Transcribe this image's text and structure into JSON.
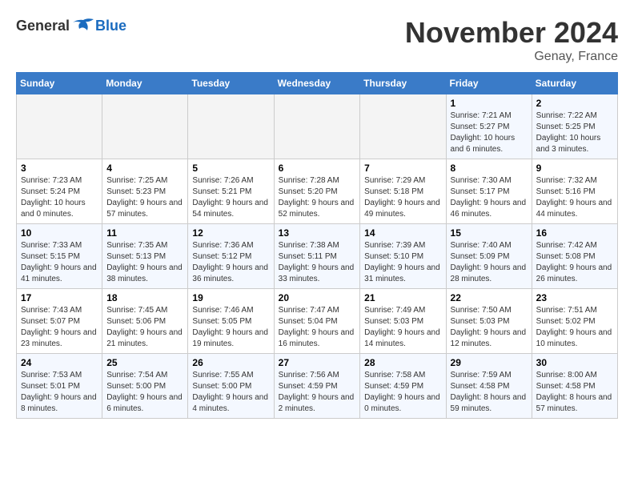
{
  "logo": {
    "general": "General",
    "blue": "Blue"
  },
  "title": "November 2024",
  "location": "Genay, France",
  "days_header": [
    "Sunday",
    "Monday",
    "Tuesday",
    "Wednesday",
    "Thursday",
    "Friday",
    "Saturday"
  ],
  "weeks": [
    [
      {
        "num": "",
        "empty": true
      },
      {
        "num": "",
        "empty": true
      },
      {
        "num": "",
        "empty": true
      },
      {
        "num": "",
        "empty": true
      },
      {
        "num": "",
        "empty": true
      },
      {
        "num": "1",
        "sunrise": "Sunrise: 7:21 AM",
        "sunset": "Sunset: 5:27 PM",
        "daylight": "Daylight: 10 hours and 6 minutes."
      },
      {
        "num": "2",
        "sunrise": "Sunrise: 7:22 AM",
        "sunset": "Sunset: 5:25 PM",
        "daylight": "Daylight: 10 hours and 3 minutes."
      }
    ],
    [
      {
        "num": "3",
        "sunrise": "Sunrise: 7:23 AM",
        "sunset": "Sunset: 5:24 PM",
        "daylight": "Daylight: 10 hours and 0 minutes."
      },
      {
        "num": "4",
        "sunrise": "Sunrise: 7:25 AM",
        "sunset": "Sunset: 5:23 PM",
        "daylight": "Daylight: 9 hours and 57 minutes."
      },
      {
        "num": "5",
        "sunrise": "Sunrise: 7:26 AM",
        "sunset": "Sunset: 5:21 PM",
        "daylight": "Daylight: 9 hours and 54 minutes."
      },
      {
        "num": "6",
        "sunrise": "Sunrise: 7:28 AM",
        "sunset": "Sunset: 5:20 PM",
        "daylight": "Daylight: 9 hours and 52 minutes."
      },
      {
        "num": "7",
        "sunrise": "Sunrise: 7:29 AM",
        "sunset": "Sunset: 5:18 PM",
        "daylight": "Daylight: 9 hours and 49 minutes."
      },
      {
        "num": "8",
        "sunrise": "Sunrise: 7:30 AM",
        "sunset": "Sunset: 5:17 PM",
        "daylight": "Daylight: 9 hours and 46 minutes."
      },
      {
        "num": "9",
        "sunrise": "Sunrise: 7:32 AM",
        "sunset": "Sunset: 5:16 PM",
        "daylight": "Daylight: 9 hours and 44 minutes."
      }
    ],
    [
      {
        "num": "10",
        "sunrise": "Sunrise: 7:33 AM",
        "sunset": "Sunset: 5:15 PM",
        "daylight": "Daylight: 9 hours and 41 minutes."
      },
      {
        "num": "11",
        "sunrise": "Sunrise: 7:35 AM",
        "sunset": "Sunset: 5:13 PM",
        "daylight": "Daylight: 9 hours and 38 minutes."
      },
      {
        "num": "12",
        "sunrise": "Sunrise: 7:36 AM",
        "sunset": "Sunset: 5:12 PM",
        "daylight": "Daylight: 9 hours and 36 minutes."
      },
      {
        "num": "13",
        "sunrise": "Sunrise: 7:38 AM",
        "sunset": "Sunset: 5:11 PM",
        "daylight": "Daylight: 9 hours and 33 minutes."
      },
      {
        "num": "14",
        "sunrise": "Sunrise: 7:39 AM",
        "sunset": "Sunset: 5:10 PM",
        "daylight": "Daylight: 9 hours and 31 minutes."
      },
      {
        "num": "15",
        "sunrise": "Sunrise: 7:40 AM",
        "sunset": "Sunset: 5:09 PM",
        "daylight": "Daylight: 9 hours and 28 minutes."
      },
      {
        "num": "16",
        "sunrise": "Sunrise: 7:42 AM",
        "sunset": "Sunset: 5:08 PM",
        "daylight": "Daylight: 9 hours and 26 minutes."
      }
    ],
    [
      {
        "num": "17",
        "sunrise": "Sunrise: 7:43 AM",
        "sunset": "Sunset: 5:07 PM",
        "daylight": "Daylight: 9 hours and 23 minutes."
      },
      {
        "num": "18",
        "sunrise": "Sunrise: 7:45 AM",
        "sunset": "Sunset: 5:06 PM",
        "daylight": "Daylight: 9 hours and 21 minutes."
      },
      {
        "num": "19",
        "sunrise": "Sunrise: 7:46 AM",
        "sunset": "Sunset: 5:05 PM",
        "daylight": "Daylight: 9 hours and 19 minutes."
      },
      {
        "num": "20",
        "sunrise": "Sunrise: 7:47 AM",
        "sunset": "Sunset: 5:04 PM",
        "daylight": "Daylight: 9 hours and 16 minutes."
      },
      {
        "num": "21",
        "sunrise": "Sunrise: 7:49 AM",
        "sunset": "Sunset: 5:03 PM",
        "daylight": "Daylight: 9 hours and 14 minutes."
      },
      {
        "num": "22",
        "sunrise": "Sunrise: 7:50 AM",
        "sunset": "Sunset: 5:03 PM",
        "daylight": "Daylight: 9 hours and 12 minutes."
      },
      {
        "num": "23",
        "sunrise": "Sunrise: 7:51 AM",
        "sunset": "Sunset: 5:02 PM",
        "daylight": "Daylight: 9 hours and 10 minutes."
      }
    ],
    [
      {
        "num": "24",
        "sunrise": "Sunrise: 7:53 AM",
        "sunset": "Sunset: 5:01 PM",
        "daylight": "Daylight: 9 hours and 8 minutes."
      },
      {
        "num": "25",
        "sunrise": "Sunrise: 7:54 AM",
        "sunset": "Sunset: 5:00 PM",
        "daylight": "Daylight: 9 hours and 6 minutes."
      },
      {
        "num": "26",
        "sunrise": "Sunrise: 7:55 AM",
        "sunset": "Sunset: 5:00 PM",
        "daylight": "Daylight: 9 hours and 4 minutes."
      },
      {
        "num": "27",
        "sunrise": "Sunrise: 7:56 AM",
        "sunset": "Sunset: 4:59 PM",
        "daylight": "Daylight: 9 hours and 2 minutes."
      },
      {
        "num": "28",
        "sunrise": "Sunrise: 7:58 AM",
        "sunset": "Sunset: 4:59 PM",
        "daylight": "Daylight: 9 hours and 0 minutes."
      },
      {
        "num": "29",
        "sunrise": "Sunrise: 7:59 AM",
        "sunset": "Sunset: 4:58 PM",
        "daylight": "Daylight: 8 hours and 59 minutes."
      },
      {
        "num": "30",
        "sunrise": "Sunrise: 8:00 AM",
        "sunset": "Sunset: 4:58 PM",
        "daylight": "Daylight: 8 hours and 57 minutes."
      }
    ]
  ]
}
